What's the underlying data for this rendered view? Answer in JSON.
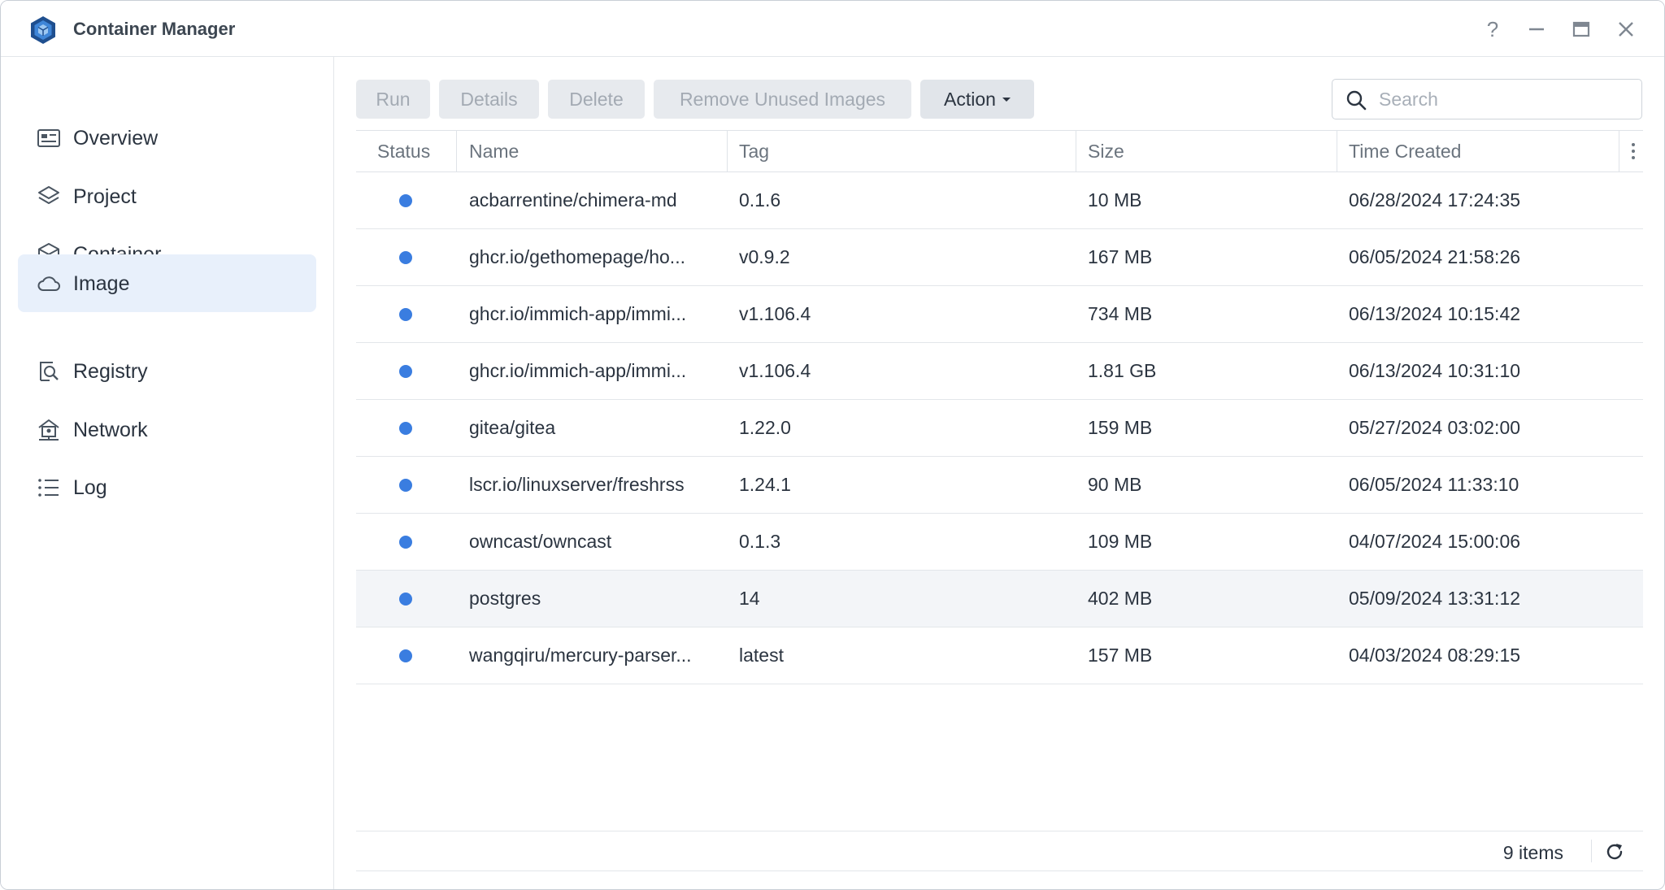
{
  "app": {
    "title": "Container Manager"
  },
  "window_controls": {
    "help": "?",
    "minimize": "minimize",
    "maximize": "maximize",
    "close": "close"
  },
  "sidebar": {
    "items": [
      {
        "label": "Overview",
        "icon": "overview-icon",
        "active": false
      },
      {
        "label": "Project",
        "icon": "layers-icon",
        "active": false
      },
      {
        "label": "Container",
        "icon": "cube-icon",
        "active": false
      },
      {
        "label": "Image",
        "icon": "cloud-icon",
        "active": true
      },
      {
        "label": "Registry",
        "icon": "registry-search-icon",
        "active": false
      },
      {
        "label": "Network",
        "icon": "network-icon",
        "active": false
      },
      {
        "label": "Log",
        "icon": "list-icon",
        "active": false
      }
    ]
  },
  "toolbar": {
    "run_label": "Run",
    "details_label": "Details",
    "delete_label": "Delete",
    "remove_unused_label": "Remove Unused Images",
    "action_label": "Action"
  },
  "search": {
    "placeholder": "Search",
    "value": ""
  },
  "table": {
    "columns": [
      "Status",
      "Name",
      "Tag",
      "Size",
      "Time Created"
    ],
    "rows": [
      {
        "name": "acbarrentine/chimera-md",
        "tag": "0.1.6",
        "size": "10 MB",
        "created": "06/28/2024 17:24:35"
      },
      {
        "name": "ghcr.io/gethomepage/ho...",
        "tag": "v0.9.2",
        "size": "167 MB",
        "created": "06/05/2024 21:58:26"
      },
      {
        "name": "ghcr.io/immich-app/immi...",
        "tag": "v1.106.4",
        "size": "734 MB",
        "created": "06/13/2024 10:15:42"
      },
      {
        "name": "ghcr.io/immich-app/immi...",
        "tag": "v1.106.4",
        "size": "1.81 GB",
        "created": "06/13/2024 10:31:10"
      },
      {
        "name": "gitea/gitea",
        "tag": "1.22.0",
        "size": "159 MB",
        "created": "05/27/2024 03:02:00"
      },
      {
        "name": "lscr.io/linuxserver/freshrss",
        "tag": "1.24.1",
        "size": "90 MB",
        "created": "06/05/2024 11:33:10"
      },
      {
        "name": "owncast/owncast",
        "tag": "0.1.3",
        "size": "109 MB",
        "created": "04/07/2024 15:00:06"
      },
      {
        "name": "postgres",
        "tag": "14",
        "size": "402 MB",
        "created": "05/09/2024 13:31:12"
      },
      {
        "name": "wangqiru/mercury-parser...",
        "tag": "latest",
        "size": "157 MB",
        "created": "04/03/2024 08:29:15"
      }
    ]
  },
  "footer": {
    "item_count": "9 items"
  },
  "colors": {
    "accent": "#3a7de0",
    "active_nav_bg": "#e8f0fb"
  }
}
